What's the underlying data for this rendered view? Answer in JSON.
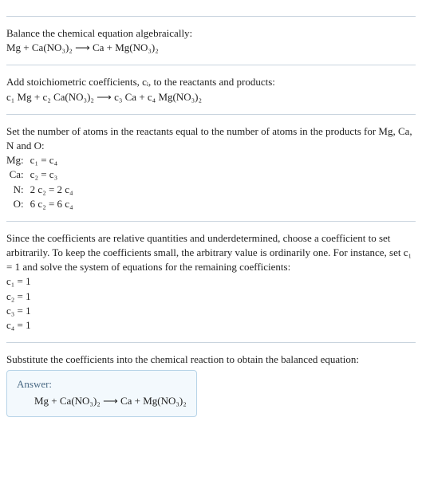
{
  "s1": {
    "title": "Balance the chemical equation algebraically:",
    "eq": "Mg + Ca(NO₃)₂ ⟶ Ca + Mg(NO₃)₂"
  },
  "s2": {
    "title": "Add stoichiometric coefficients, cᵢ, to the reactants and products:",
    "eq": "c₁ Mg + c₂ Ca(NO₃)₂ ⟶ c₃ Ca + c₄ Mg(NO₃)₂"
  },
  "s3": {
    "title": "Set the number of atoms in the reactants equal to the number of atoms in the products for Mg, Ca, N and O:",
    "rows": [
      {
        "label": "Mg:",
        "eq": "c₁ = c₄"
      },
      {
        "label": "Ca:",
        "eq": "c₂ = c₃"
      },
      {
        "label": "N:",
        "eq": "2 c₂ = 2 c₄"
      },
      {
        "label": "O:",
        "eq": "6 c₂ = 6 c₄"
      }
    ]
  },
  "s4": {
    "title": "Since the coefficients are relative quantities and underdetermined, choose a coefficient to set arbitrarily. To keep the coefficients small, the arbitrary value is ordinarily one. For instance, set c₁ = 1 and solve the system of equations for the remaining coefficients:",
    "lines": [
      "c₁ = 1",
      "c₂ = 1",
      "c₃ = 1",
      "c₄ = 1"
    ]
  },
  "s5": {
    "title": "Substitute the coefficients into the chemical reaction to obtain the balanced equation:",
    "answer_label": "Answer:",
    "answer_eq": "Mg + Ca(NO₃)₂ ⟶ Ca + Mg(NO₃)₂"
  }
}
